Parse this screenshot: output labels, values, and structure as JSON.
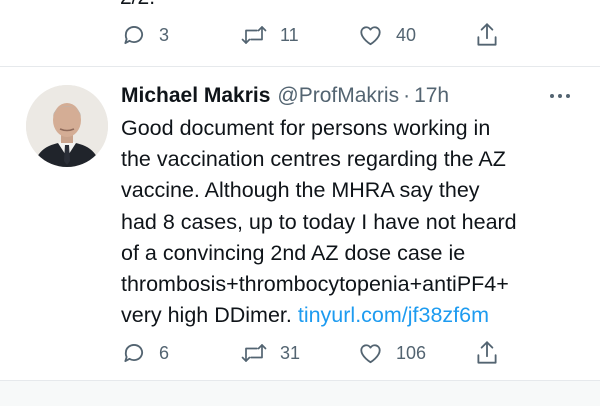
{
  "previous_tweet": {
    "cut_text": "2/2.",
    "actions": {
      "reply_count": "3",
      "retweet_count": "11",
      "like_count": "40"
    }
  },
  "tweet": {
    "author_name": "Michael Makris",
    "author_handle": "@ProfMakris",
    "separator": "·",
    "time": "17h",
    "lines": [
      "Good document for persons working in",
      "the vaccination centres regarding the AZ",
      "vaccine. Although the MHRA say they",
      "had 8 cases, up to today I have not heard",
      "of a convincing 2nd AZ dose case ie",
      "thrombosis+thrombocytopenia+antiPF4+"
    ],
    "last_line_text": "very high DDimer.",
    "link": "tinyurl.com/jf38zf6m",
    "actions": {
      "reply_count": "6",
      "retweet_count": "31",
      "like_count": "106"
    }
  },
  "colors": {
    "text": "#0f1419",
    "secondary": "#536471",
    "link": "#1d9bf0",
    "divider": "#e6e9ec"
  },
  "icons": [
    "reply-icon",
    "retweet-icon",
    "like-icon",
    "share-icon",
    "more-icon"
  ]
}
